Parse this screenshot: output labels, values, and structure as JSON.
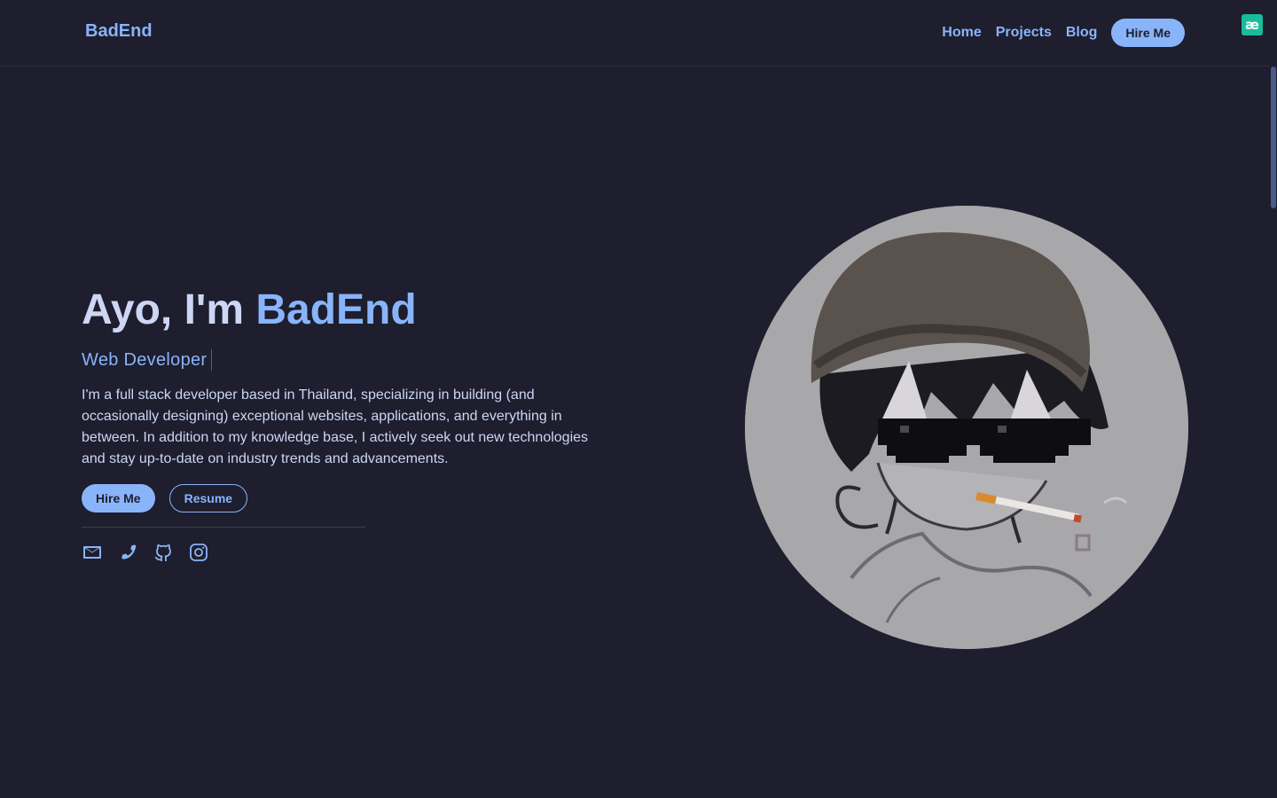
{
  "nav": {
    "brand": "BadEnd",
    "links": [
      "Home",
      "Projects",
      "Blog"
    ],
    "hire_label": "Hire Me"
  },
  "extension_badge": "æ",
  "hero": {
    "greeting": "Ayo, I'm ",
    "name": "BadEnd",
    "role": "Web Developer",
    "bio": "I'm a full stack developer based in Thailand, specializing in building (and occasionally designing) exceptional websites, applications, and everything in between. In addition to my knowledge base, I actively seek out new technologies and stay up-to-date on industry trends and advancements.",
    "hire_label": "Hire Me",
    "resume_label": "Resume"
  },
  "socials": [
    "mail-icon",
    "phone-icon",
    "github-icon",
    "instagram-icon"
  ],
  "colors": {
    "background": "#1e1e2e",
    "accent": "#89b4fa",
    "text": "#cdd6f4"
  }
}
